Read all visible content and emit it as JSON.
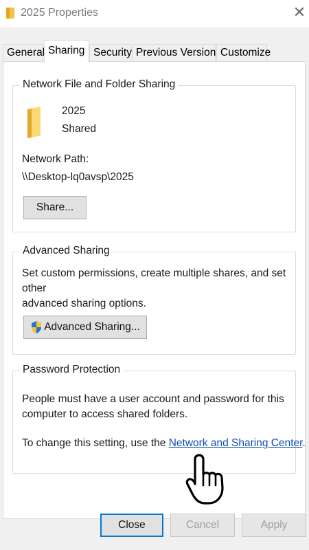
{
  "window": {
    "title": "2025 Properties",
    "close_icon": "close-icon"
  },
  "tabs": [
    {
      "label": "General",
      "active": false
    },
    {
      "label": "Sharing",
      "active": true
    },
    {
      "label": "Security",
      "active": false
    },
    {
      "label": "Previous Versions",
      "active": false
    },
    {
      "label": "Customize",
      "active": false
    }
  ],
  "network_sharing": {
    "group_title": "Network File and Folder Sharing",
    "folder_name": "2025",
    "folder_status": "Shared",
    "path_label": "Network Path:",
    "path_value": "\\\\Desktop-lq0avsp\\2025",
    "share_button": "Share..."
  },
  "advanced_sharing": {
    "group_title": "Advanced Sharing",
    "description_line1": "Set custom permissions, create multiple shares, and set other",
    "description_line2": "advanced sharing options.",
    "button_label": "Advanced Sharing..."
  },
  "password_protection": {
    "group_title": "Password Protection",
    "description_line1": "People must have a user account and password for this",
    "description_line2": "computer to access shared folders.",
    "change_prefix": "To change this setting, use the ",
    "link_text": "Network and Sharing Center",
    "change_suffix": "."
  },
  "footer": {
    "close_label": "Close",
    "cancel_label": "Cancel",
    "apply_label": "Apply"
  },
  "colors": {
    "accent": "#0078d7",
    "link": "#0b4fb3",
    "folder": "#f4c244"
  }
}
